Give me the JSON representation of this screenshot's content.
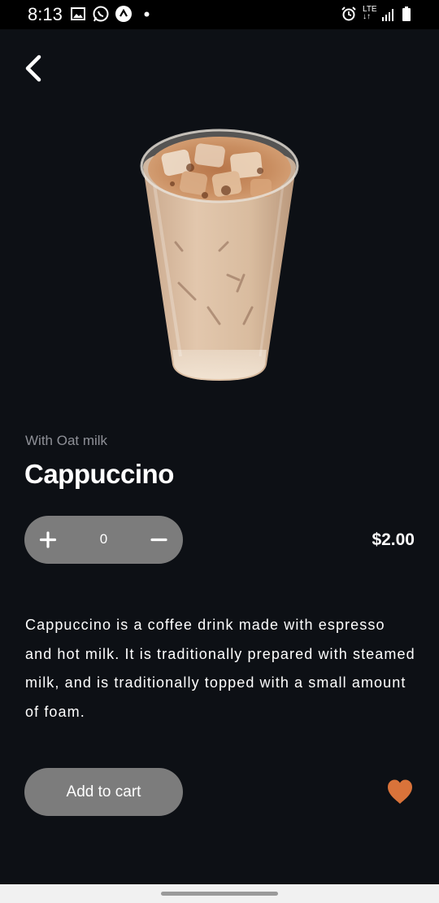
{
  "status_bar": {
    "time": "8:13",
    "network": "LTE",
    "icons": [
      "image-icon",
      "whatsapp-icon",
      "app-icon",
      "dot-icon",
      "alarm-icon",
      "lte-icon",
      "signal-icon",
      "battery-icon"
    ]
  },
  "header": {
    "back_icon": "chevron-left-icon"
  },
  "product": {
    "image": "iced-coffee-glass",
    "subtitle": "With Oat milk",
    "name": "Cappuccino",
    "quantity": "0",
    "price": "$2.00",
    "description": "Cappuccino is a coffee drink made with espresso and hot milk. It is traditionally prepared with steamed milk, and is traditionally topped with a small amount of foam."
  },
  "actions": {
    "add_to_cart_label": "Add to cart",
    "favorite_icon": "heart-icon"
  },
  "colors": {
    "background": "#0d1015",
    "pill": "#7c7c7c",
    "accent": "#d9733a",
    "muted_text": "#8e9097"
  }
}
